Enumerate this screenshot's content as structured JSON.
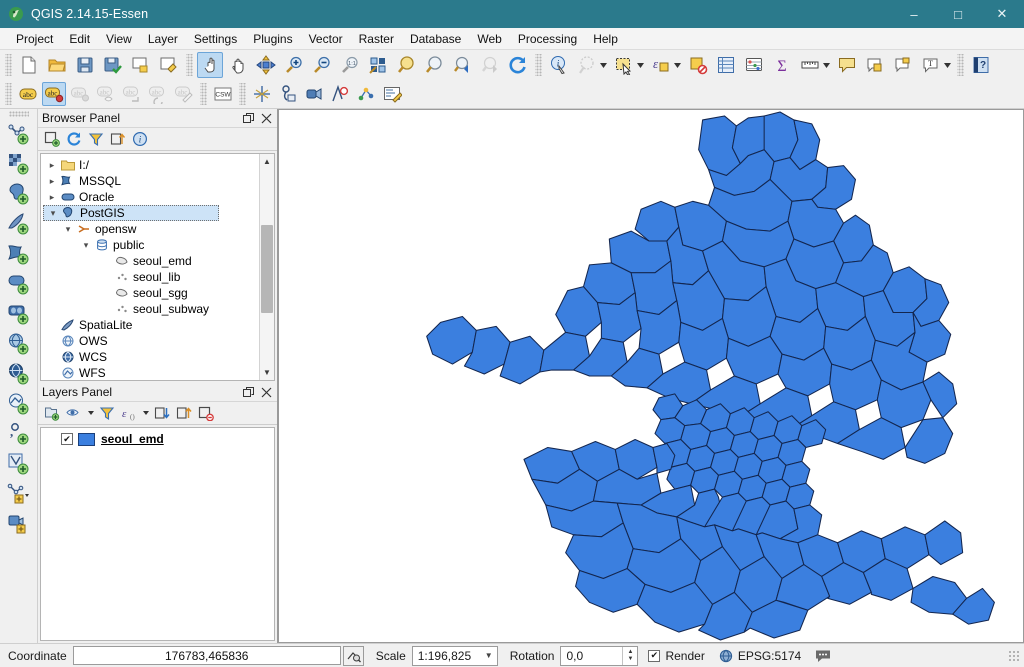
{
  "window": {
    "title": "QGIS 2.14.15-Essen",
    "logo_icon": "qgis-logo-icon",
    "minimize": "‒",
    "maximize": "□",
    "close": "✕"
  },
  "menubar": {
    "items": [
      {
        "label": "Project"
      },
      {
        "label": "Edit"
      },
      {
        "label": "View"
      },
      {
        "label": "Layer"
      },
      {
        "label": "Settings"
      },
      {
        "label": "Plugins"
      },
      {
        "label": "Vector"
      },
      {
        "label": "Raster"
      },
      {
        "label": "Database"
      },
      {
        "label": "Web"
      },
      {
        "label": "Processing"
      },
      {
        "label": "Help"
      }
    ]
  },
  "toolbar_row1": {
    "groups": [
      {
        "buttons": [
          {
            "icon": "new-project-icon",
            "title": "New Project"
          },
          {
            "icon": "open-project-icon",
            "title": "Open Project"
          },
          {
            "icon": "save-project-icon",
            "title": "Save Project"
          },
          {
            "icon": "save-project-as-icon",
            "title": "Save Project As"
          },
          {
            "icon": "new-print-composer-icon",
            "title": "New Print Composer"
          },
          {
            "icon": "composer-manager-icon",
            "title": "Composer Manager"
          }
        ]
      },
      {
        "buttons": [
          {
            "icon": "touch-zoom-pan-icon",
            "title": "Touch Zoom and Pan",
            "active": true
          },
          {
            "icon": "pan-map-icon",
            "title": "Pan Map"
          },
          {
            "icon": "pan-to-selection-icon",
            "title": "Pan Map to Selection"
          },
          {
            "icon": "zoom-in-icon",
            "title": "Zoom In"
          },
          {
            "icon": "zoom-out-icon",
            "title": "Zoom Out"
          },
          {
            "icon": "zoom-native-icon",
            "title": "Zoom to Native Resolution"
          },
          {
            "icon": "zoom-full-icon",
            "title": "Zoom Full"
          },
          {
            "icon": "zoom-to-selection-icon",
            "title": "Zoom to Selection"
          },
          {
            "icon": "zoom-to-layer-icon",
            "title": "Zoom to Layer"
          },
          {
            "icon": "zoom-last-icon",
            "title": "Zoom Last"
          },
          {
            "icon": "zoom-next-icon",
            "title": "Zoom Next",
            "disabled": true
          },
          {
            "icon": "refresh-icon",
            "title": "Refresh"
          }
        ]
      },
      {
        "buttons": [
          {
            "icon": "identify-features-icon",
            "title": "Identify Features"
          },
          {
            "icon": "map-tips-icon",
            "title": "Show Map Tips",
            "disabled": true,
            "caret": true
          },
          {
            "icon": "select-features-icon",
            "title": "Select Features by Area",
            "caret": true
          },
          {
            "icon": "select-by-expression-icon",
            "title": "Select by Expression",
            "caret": true
          },
          {
            "icon": "deselect-features-icon",
            "title": "Deselect Features"
          },
          {
            "icon": "open-attribute-table-icon",
            "title": "Open Attribute Table"
          },
          {
            "icon": "field-calculator-icon",
            "title": "Open Field Calculator"
          },
          {
            "icon": "statistical-summary-icon",
            "title": "Show Statistical Summary"
          },
          {
            "icon": "measure-line-icon",
            "title": "Measure Line",
            "caret": true
          },
          {
            "icon": "text-annotation-icon",
            "title": "Text Annotation"
          },
          {
            "icon": "html-annotation-icon",
            "title": "HTML Annotation"
          },
          {
            "icon": "form-annotation-icon",
            "title": "Form Annotation"
          },
          {
            "icon": "new-text-label-icon",
            "title": "New Text Label",
            "caret": true
          }
        ]
      },
      {
        "buttons": [
          {
            "icon": "help-contents-icon",
            "title": "Help Contents"
          }
        ]
      }
    ]
  },
  "toolbar_row2": {
    "groups": [
      {
        "buttons": [
          {
            "icon": "label-layer-icon",
            "title": "Layer Labeling Options"
          },
          {
            "icon": "highlight-pinned-labels-icon",
            "title": "Highlight Pinned Labels",
            "active": true
          },
          {
            "icon": "pin-labels-icon",
            "title": "Pin/Unpin Labels",
            "disabled": true
          },
          {
            "icon": "show-hide-labels-icon",
            "title": "Show/Hide Labels",
            "disabled": true
          },
          {
            "icon": "move-label-icon",
            "title": "Move Label",
            "disabled": true
          },
          {
            "icon": "rotate-label-icon",
            "title": "Rotate Label",
            "disabled": true
          },
          {
            "icon": "change-label-icon",
            "title": "Change Label",
            "disabled": true
          }
        ]
      },
      {
        "buttons": [
          {
            "icon": "csw-metasearch-icon",
            "title": "MetaSearch (CSW)"
          }
        ]
      },
      {
        "buttons": [
          {
            "icon": "georeferencer-icon",
            "title": "Georeferencer"
          },
          {
            "icon": "gps-tools-icon",
            "title": "GPS Tools"
          },
          {
            "icon": "openstreetmap-icon",
            "title": "OpenStreetMap"
          },
          {
            "icon": "road-graph-icon",
            "title": "Road Graph"
          },
          {
            "icon": "network-analysis-icon",
            "title": "Network Analysis"
          },
          {
            "icon": "plugin-editor-icon",
            "title": "Plugin Editor"
          }
        ]
      }
    ]
  },
  "left_toolbar": {
    "buttons": [
      {
        "icon": "add-vector-layer-icon",
        "title": "Add Vector Layer"
      },
      {
        "icon": "add-raster-layer-icon",
        "title": "Add Raster Layer"
      },
      {
        "icon": "add-postgis-layer-icon",
        "title": "Add PostGIS Layers"
      },
      {
        "icon": "add-spatialite-layer-icon",
        "title": "Add SpatiaLite Layer"
      },
      {
        "icon": "add-mssql-layer-icon",
        "title": "Add MSSQL Spatial Layer"
      },
      {
        "icon": "add-oracle-layer-icon",
        "title": "Add Oracle Spatial Layer"
      },
      {
        "icon": "add-db2-layer-icon",
        "title": "Add DB2 Spatial Layer"
      },
      {
        "icon": "add-wms-layer-icon",
        "title": "Add WMS/WMTS Layer"
      },
      {
        "icon": "add-wcs-layer-icon",
        "title": "Add WCS Layer"
      },
      {
        "icon": "add-wfs-layer-icon",
        "title": "Add WFS Layer"
      },
      {
        "icon": "add-delimited-text-layer-icon",
        "title": "Add Delimited Text Layer"
      },
      {
        "icon": "add-virtual-layer-icon",
        "title": "Add Virtual Layer"
      },
      {
        "icon": "new-shapefile-layer-icon",
        "title": "New Shapefile Layer",
        "caret": true
      },
      {
        "icon": "new-memory-layer-icon",
        "title": "New Temporary Scratch Layer"
      }
    ]
  },
  "browser_panel": {
    "title": "Browser Panel",
    "float_icon": "float-panel-icon",
    "close_icon": "close-panel-icon",
    "toolbar": [
      {
        "icon": "add-selected-layers-icon",
        "title": "Add Selected Layers"
      },
      {
        "icon": "refresh-icon",
        "title": "Refresh"
      },
      {
        "icon": "filter-browser-icon",
        "title": "Filter Browser"
      },
      {
        "icon": "collapse-all-icon",
        "title": "Collapse All"
      },
      {
        "icon": "properties-icon",
        "title": "Properties"
      }
    ],
    "tree": [
      {
        "label": "I:/",
        "indent": 0,
        "twist": "collapsed",
        "icon": "folder-icon"
      },
      {
        "label": "MSSQL",
        "indent": 0,
        "twist": "collapsed",
        "icon": "mssql-icon"
      },
      {
        "label": "Oracle",
        "indent": 0,
        "twist": "collapsed",
        "icon": "oracle-icon"
      },
      {
        "label": "PostGIS",
        "indent": 0,
        "twist": "expanded",
        "icon": "postgis-icon",
        "selected": true
      },
      {
        "label": "opensw",
        "indent": 1,
        "twist": "expanded",
        "icon": "db-connection-icon"
      },
      {
        "label": "public",
        "indent": 2,
        "twist": "expanded",
        "icon": "schema-icon"
      },
      {
        "label": "seoul_emd",
        "indent": 3,
        "twist": "none",
        "icon": "polygon-layer-icon"
      },
      {
        "label": "seoul_lib",
        "indent": 3,
        "twist": "none",
        "icon": "point-layer-icon"
      },
      {
        "label": "seoul_sgg",
        "indent": 3,
        "twist": "none",
        "icon": "polygon-layer-icon"
      },
      {
        "label": "seoul_subway",
        "indent": 3,
        "twist": "none",
        "icon": "point-layer-icon"
      },
      {
        "label": "SpatiaLite",
        "indent": 0,
        "twist": "none",
        "icon": "spatialite-icon"
      },
      {
        "label": "OWS",
        "indent": 0,
        "twist": "none",
        "icon": "ows-icon"
      },
      {
        "label": "WCS",
        "indent": 0,
        "twist": "none",
        "icon": "wcs-icon"
      },
      {
        "label": "WFS",
        "indent": 0,
        "twist": "none",
        "icon": "wfs-icon"
      }
    ]
  },
  "layers_panel": {
    "title": "Layers Panel",
    "float_icon": "float-panel-icon",
    "close_icon": "close-panel-icon",
    "toolbar": [
      {
        "icon": "add-group-icon",
        "title": "Add Group"
      },
      {
        "icon": "manage-layer-visibility-icon",
        "title": "Manage Layer Visibility",
        "caret": true
      },
      {
        "icon": "filter-legend-icon",
        "title": "Filter Legend by Map Content"
      },
      {
        "icon": "filter-legend-expression-icon",
        "title": "Filter Legend by Expression",
        "caret": true
      },
      {
        "icon": "expand-all-icon",
        "title": "Expand All"
      },
      {
        "icon": "collapse-all-icon",
        "title": "Collapse All"
      },
      {
        "icon": "remove-layer-icon",
        "title": "Remove Layer/Group"
      }
    ],
    "layers": [
      {
        "name": "seoul_emd",
        "checked": true,
        "check_mark": "✔",
        "swatch_color": "#3b7fdf"
      }
    ]
  },
  "map": {
    "fill_color": "#3b7fdf",
    "stroke_color": "#13264f",
    "background": "#ffffff"
  },
  "statusbar": {
    "coordinate_label": "Coordinate",
    "coordinate_value": "176783,465836",
    "coordinate_toggle_icon": "toggle-extents-icon",
    "scale_label": "Scale",
    "scale_value": "1:196,825",
    "rotation_label": "Rotation",
    "rotation_value": "0,0",
    "render_label": "Render",
    "render_checked": true,
    "render_check_mark": "✔",
    "crs_label": "EPSG:5174",
    "crs_icon": "crs-globe-icon",
    "messages_icon": "messages-icon"
  }
}
